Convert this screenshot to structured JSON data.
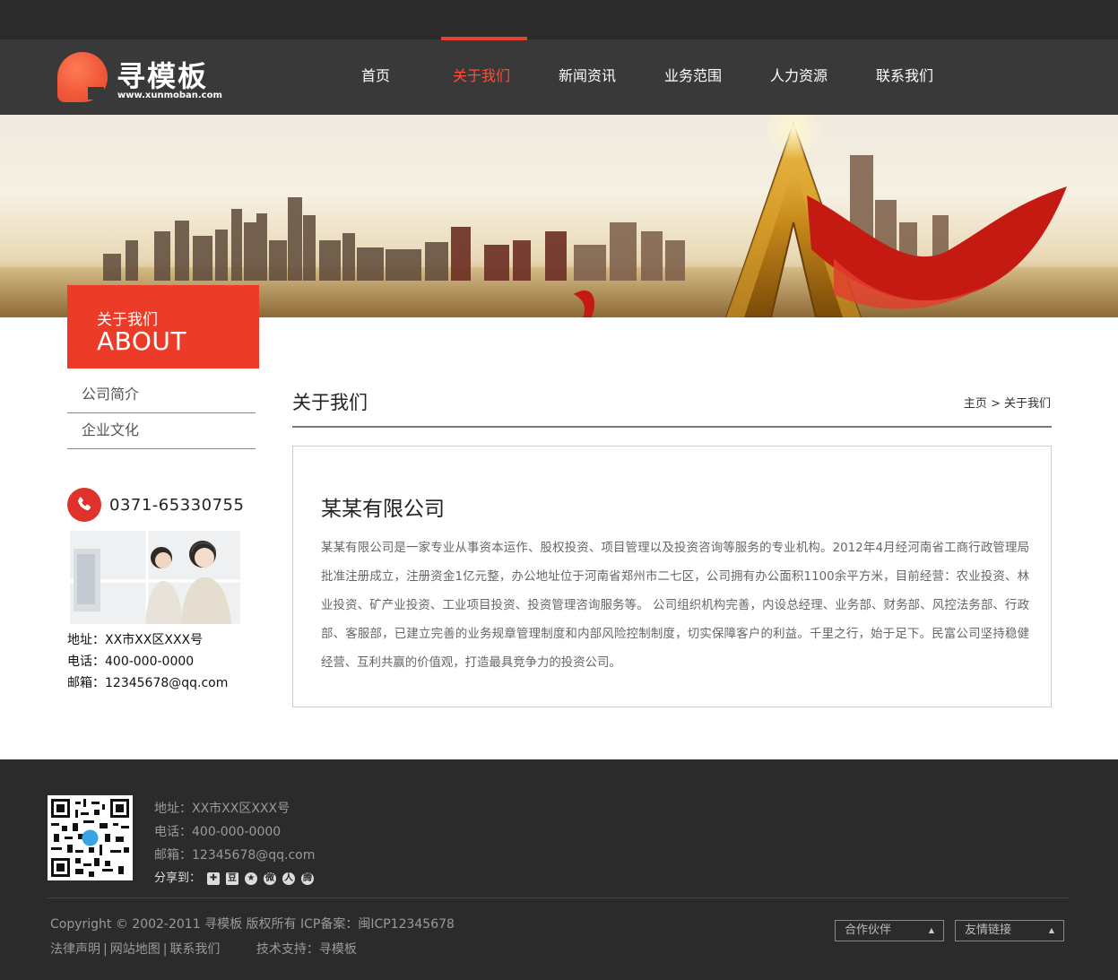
{
  "brand": {
    "name": "寻模板",
    "url": "www.xunmoban.com"
  },
  "nav": {
    "items": [
      {
        "label": "首页"
      },
      {
        "label": "关于我们",
        "active": true
      },
      {
        "label": "新闻资讯"
      },
      {
        "label": "业务范围"
      },
      {
        "label": "人力资源"
      },
      {
        "label": "联系我们"
      }
    ]
  },
  "sidebar": {
    "section_cn": "关于我们",
    "section_en": "ABOUT",
    "menu": [
      {
        "label": "公司简介"
      },
      {
        "label": "企业文化"
      }
    ],
    "phone": "0371-65330755",
    "contact": {
      "address": "地址：XX市XX区XXX号",
      "tel": "电话：400-000-0000",
      "email": "邮箱：12345678@qq.com"
    }
  },
  "main": {
    "title": "关于我们",
    "breadcrumb": "主页 > 关于我们",
    "company_name": "某某有限公司",
    "description": "某某有限公司是一家专业从事资本运作、股权投资、项目管理以及投资咨询等服务的专业机构。2012年4月经河南省工商行政管理局批准注册成立，注册资金1亿元整，办公地址位于河南省郑州市二七区，公司拥有办公面积1100余平方米，目前经营：农业投资、林业投资、矿产业投资、工业项目投资、投资管理咨询服务等。 公司组织机构完善，内设总经理、业务部、财务部、风控法务部、行政部、客服部，已建立完善的业务规章管理制度和内部风险控制制度，切实保障客户的利益。千里之行，始于足下。民富公司坚持稳健经营、互利共赢的价值观，打造最具竞争力的投资公司。"
  },
  "footer": {
    "address": "地址：XX市XX区XXX号",
    "tel": "电话：400-000-0000",
    "email": "邮箱：12345678@qq.com",
    "share_label": "分享到：",
    "share_icons": [
      "qzone-icon",
      "douban-icon",
      "favorite-icon",
      "weibo-icon",
      "renren-icon",
      "tqq-icon"
    ],
    "copyright": "Copyright © 2002-2011 寻模板 版权所有   ICP备案：闽ICP12345678",
    "links": {
      "legal": "法律声明",
      "sitemap": "网站地图",
      "contact": "联系我们",
      "tech_support": "技术支持：寻模板"
    },
    "partner_select": "合作伙伴",
    "friend_links_select": "友情链接"
  },
  "colors": {
    "accent": "#ec3b28",
    "header_bg": "#393939",
    "footer_bg": "#2b2b2b"
  }
}
